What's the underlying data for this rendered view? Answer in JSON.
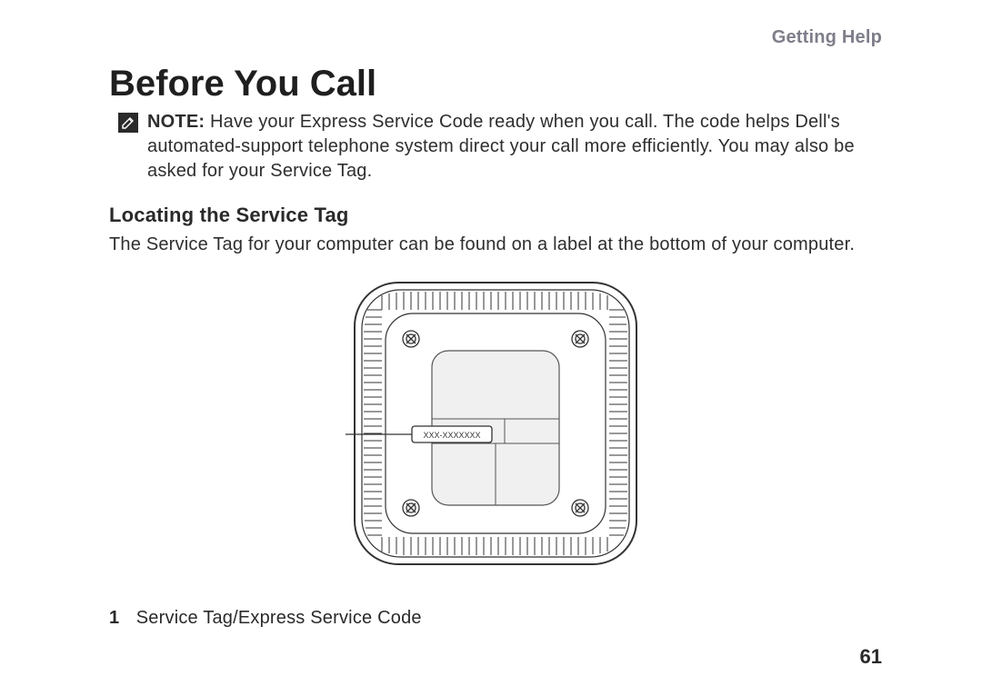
{
  "header": {
    "section": "Getting Help"
  },
  "heading": "Before You Call",
  "note": {
    "label": "NOTE:",
    "text": "Have your Express Service Code ready when you call. The code helps Dell's automated-support telephone system direct your call more efficiently. You may also be asked for your Service Tag."
  },
  "subheading": "Locating the Service Tag",
  "paragraph": "The Service Tag for your computer can be found on a label at the bottom of your computer.",
  "figure": {
    "callout_number": "1",
    "label_text": "XXX-XXXXXXX"
  },
  "legend": {
    "items": [
      {
        "num": "1",
        "text": "Service Tag/Express Service Code"
      }
    ]
  },
  "page_number": "61"
}
